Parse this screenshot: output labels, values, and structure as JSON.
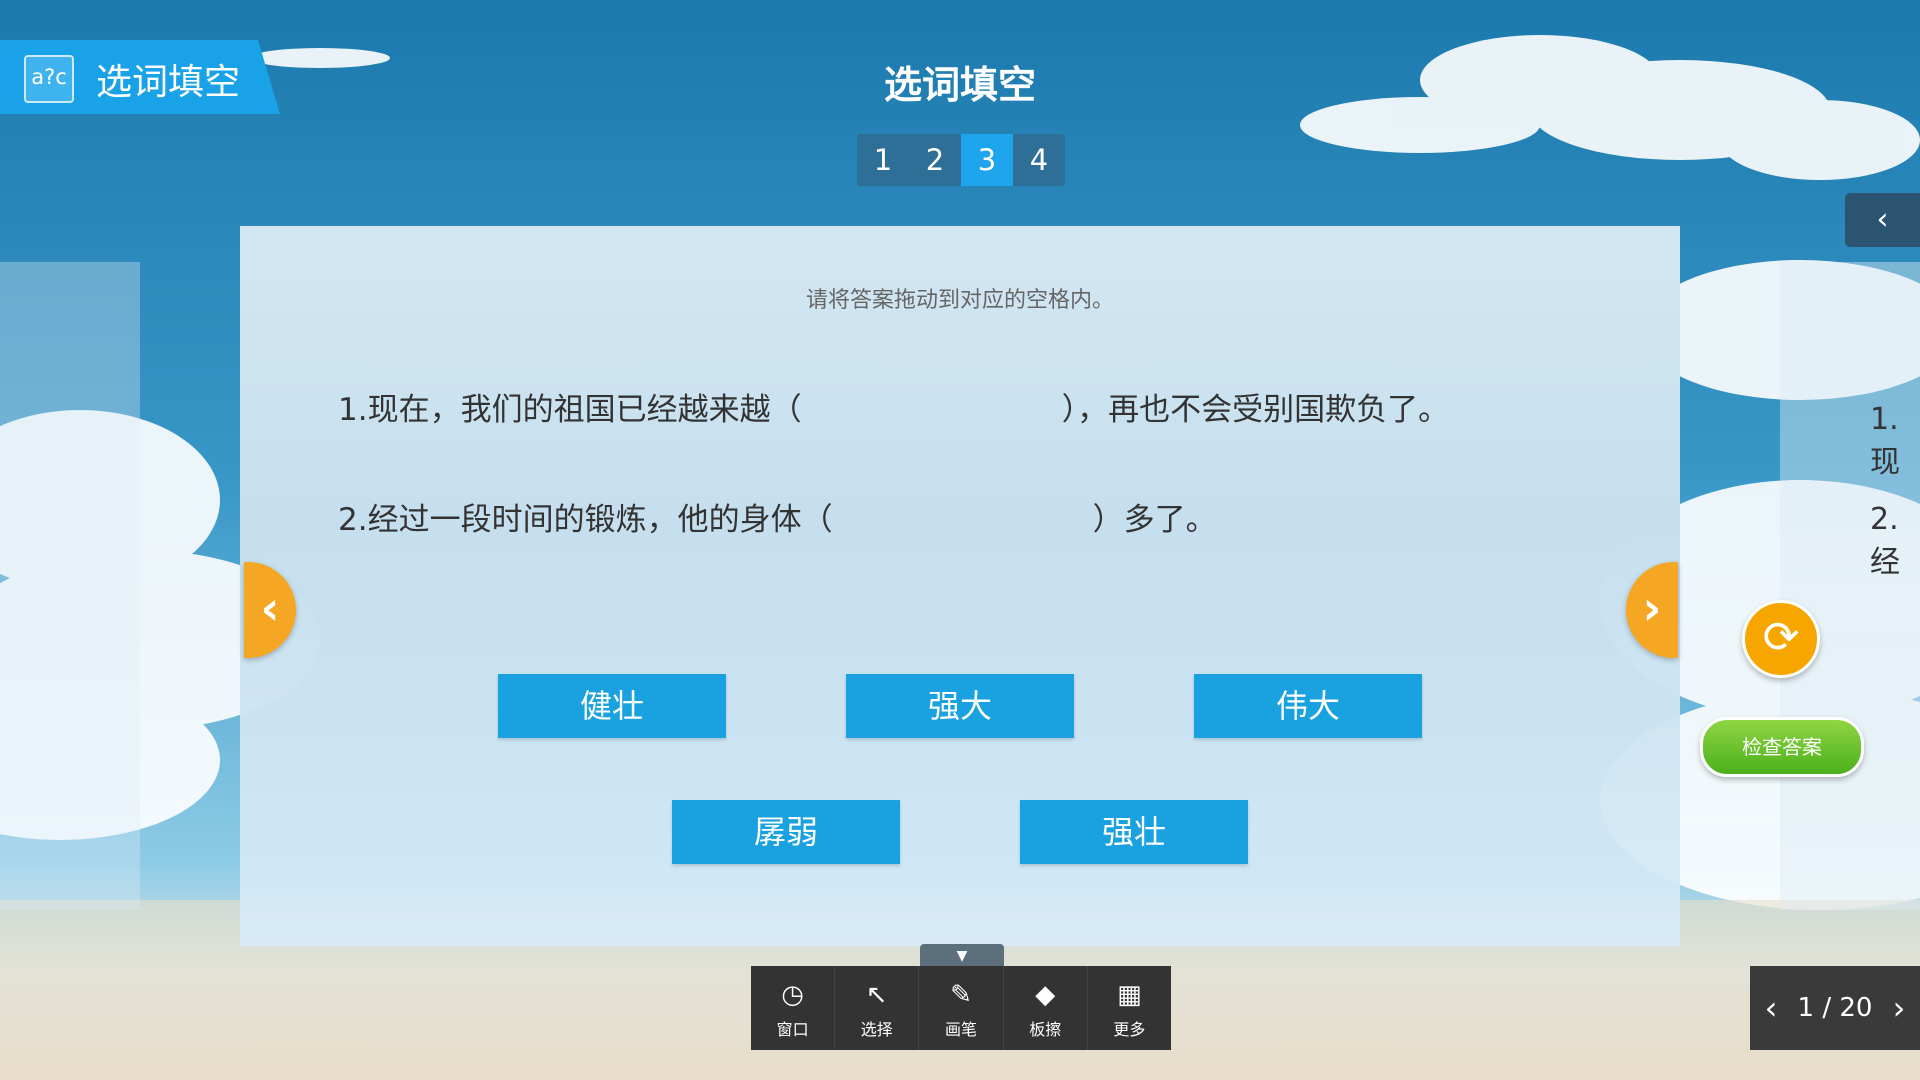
{
  "header": {
    "badge_icon": "a?c",
    "badge_label": "选词填空",
    "title": "选词填空"
  },
  "pager": {
    "pages": [
      "1",
      "2",
      "3",
      "4"
    ],
    "active_index": 2
  },
  "side_preview": {
    "line1": "1.现",
    "line2": "2.经"
  },
  "card": {
    "instruction": "请将答案拖动到对应的空格内。",
    "q1_before": "1.现在，我们的祖国已经越来越（",
    "q1_after": "），再也不会受别国欺负了。",
    "q2_before": "2.经过一段时间的锻炼，他的身体（",
    "q2_after": "）多了。",
    "options": [
      "健壮",
      "强大",
      "伟大",
      "孱弱",
      "强壮"
    ]
  },
  "actions": {
    "check_label": "检查答案",
    "refresh_icon": "refresh-icon"
  },
  "toolbar": {
    "items": [
      {
        "label": "窗口",
        "icon": "clock-icon"
      },
      {
        "label": "选择",
        "icon": "pointer-icon"
      },
      {
        "label": "画笔",
        "icon": "pen-icon"
      },
      {
        "label": "板擦",
        "icon": "eraser-icon"
      },
      {
        "label": "更多",
        "icon": "grid-icon"
      }
    ]
  },
  "page_counter": {
    "text": "1 / 20"
  },
  "colors": {
    "sky": "#1f7fb5",
    "accent_blue": "#1aa2e8",
    "orange": "#f5a623",
    "green": "#5ebc2b"
  }
}
